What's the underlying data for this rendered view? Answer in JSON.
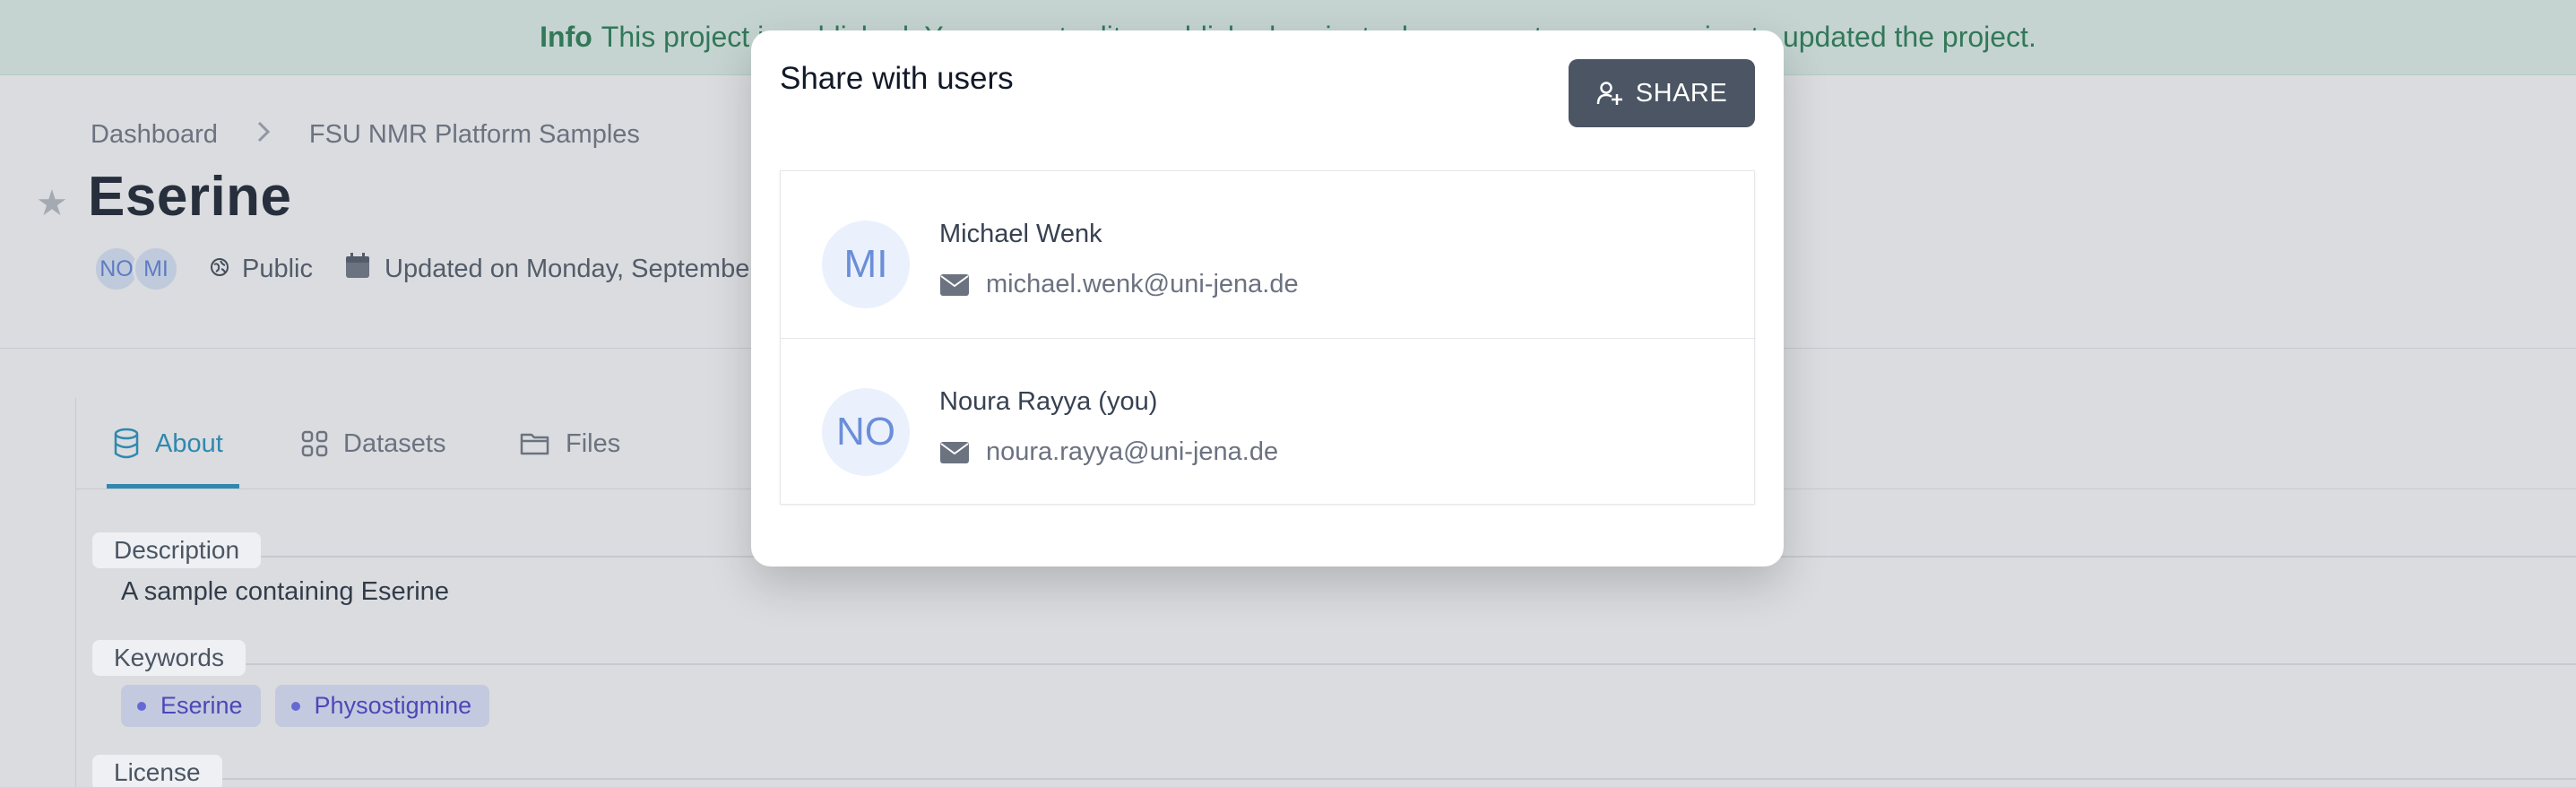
{
  "banner": {
    "label": "Info",
    "message": "This project is published. You cannot edit a published project, please create a new version to updated the project."
  },
  "breadcrumb": {
    "items": [
      "Dashboard",
      "FSU NMR Platform Samples"
    ]
  },
  "project": {
    "title": "Eserine",
    "avatars": [
      "NO",
      "MI"
    ],
    "visibility": "Public",
    "updated": "Updated on Monday, September"
  },
  "tabs": [
    {
      "label": "About",
      "icon": "database-icon",
      "active": true
    },
    {
      "label": "Datasets",
      "icon": "grid-icon",
      "active": false
    },
    {
      "label": "Files",
      "icon": "folder-icon",
      "active": false
    }
  ],
  "about": {
    "description_label": "Description",
    "description": "A sample containing Eserine",
    "keywords_label": "Keywords",
    "keywords": [
      "Eserine",
      "Physostigmine"
    ],
    "license_label": "License"
  },
  "modal": {
    "title": "Share with users",
    "share_label": "SHARE",
    "users": [
      {
        "initials": "MI",
        "name": "Michael Wenk",
        "email": "michael.wenk@uni-jena.de"
      },
      {
        "initials": "NO",
        "name": "Noura Rayya (you)",
        "email": "noura.rayya@uni-jena.de"
      }
    ]
  },
  "colors": {
    "accent": "#1d8fbf",
    "banner_bg": "#e3f5ec",
    "banner_text": "#1f7a4d",
    "share_button": "#4b5563",
    "keyword_chip": "#e0e7ff"
  }
}
